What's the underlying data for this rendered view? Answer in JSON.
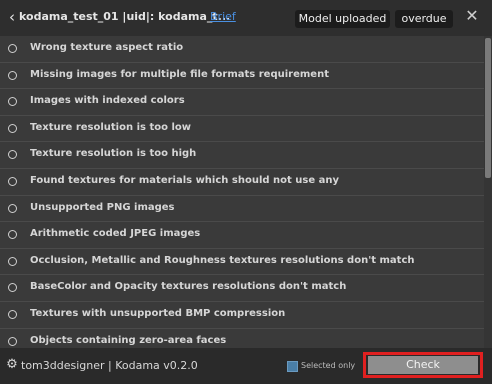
{
  "header": {
    "back_icon": "chevron-left-icon",
    "title": "kodama_test_01 |uid|: kodama_t...",
    "brief_link": "Brief",
    "status_badge": "Model uploaded",
    "deadline_badge": "overdue",
    "close_icon": "close-icon"
  },
  "checks": [
    {
      "label": "Wrong texture aspect ratio"
    },
    {
      "label": "Missing images for multiple file formats requirement"
    },
    {
      "label": "Images with indexed colors"
    },
    {
      "label": "Texture resolution is too low"
    },
    {
      "label": "Texture resolution is too high"
    },
    {
      "label": "Found textures for materials which should not use any"
    },
    {
      "label": "Unsupported PNG images"
    },
    {
      "label": "Arithmetic coded JPEG images"
    },
    {
      "label": "Occlusion, Metallic and Roughness textures resolutions don't match"
    },
    {
      "label": "BaseColor and Opacity textures resolutions don't match"
    },
    {
      "label": "Textures with unsupported BMP compression"
    },
    {
      "label": "Objects containing zero-area faces"
    }
  ],
  "footer": {
    "settings_icon": "gear-icon",
    "brand": "tom3ddesigner | Kodama v0.2.0",
    "selected_only_label": "Selected only",
    "selected_only_checked": true,
    "check_button": "Check"
  },
  "colors": {
    "accent_link": "#4a90e2",
    "highlight_outline": "#e02020"
  }
}
